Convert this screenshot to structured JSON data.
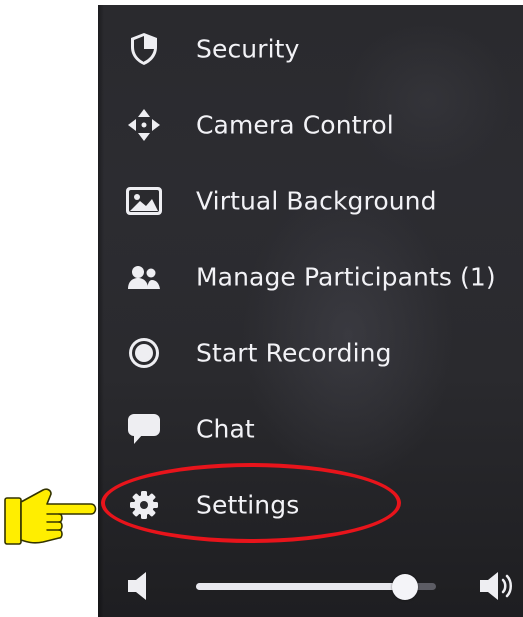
{
  "menu": {
    "items": [
      {
        "label": "Security",
        "icon": "shield-icon"
      },
      {
        "label": "Camera Control",
        "icon": "move-arrows-icon"
      },
      {
        "label": "Virtual Background",
        "icon": "image-icon"
      },
      {
        "label": "Manage Participants (1)",
        "icon": "participants-icon"
      },
      {
        "label": "Start Recording",
        "icon": "record-icon"
      },
      {
        "label": "Chat",
        "icon": "chat-bubble-icon"
      },
      {
        "label": "Settings",
        "icon": "gear-icon"
      }
    ]
  },
  "volume": {
    "level": 0.87,
    "low_icon": "speaker-low-icon",
    "high_icon": "speaker-high-icon"
  },
  "annotation": {
    "highlight_target": "Settings",
    "highlight_color": "#e8141b",
    "pointer_color": "#ffee00",
    "pointer_icon": "pointing-hand-icon"
  },
  "colors": {
    "panel_background": "#2a2a2e",
    "text": "#f2f2f6",
    "icon": "#eeeef2"
  }
}
